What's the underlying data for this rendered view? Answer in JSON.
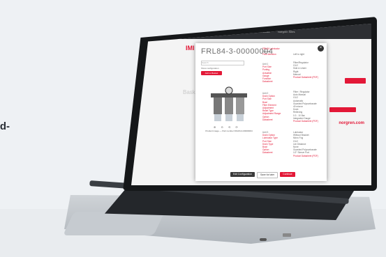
{
  "left_text": "rd-",
  "site": {
    "logo": "IMI",
    "heading": "Basket",
    "brand": "norgren.com",
    "topbar_links": [
      "Login",
      "Contact",
      "Norgren Sites"
    ]
  },
  "modal": {
    "title": "FRL84-3-00000004",
    "search_placeholder": "Search",
    "checkbox_label": "Show configuration",
    "add_button": "Add to Basket",
    "caption": "Product image — Part number FRL84-3-00000004",
    "thumb_icons": "⊕ ⊖ ⟲ ⟳",
    "close_label": "×",
    "buttons": {
      "edit": "Edit Configuration",
      "save": "Save for later",
      "continue": "Continue"
    },
    "spec_sections": [
      {
        "heading": "FRL84 Lubricator",
        "items": [
          "Options",
          "Flow direction"
        ],
        "values": [
          "Left to right"
        ]
      },
      {
        "heading": "Unit 1",
        "items": [
          "Port Size",
          "Porting",
          "Actuation",
          "Gauge",
          "Function",
          "Datasheet"
        ],
        "values": [
          "Filter/Regulator",
          "G1/2",
          "Side & Under",
          "Right",
          "Manual",
          "Product Datasheet (PDF)"
        ]
      },
      {
        "heading": "Unit 2",
        "items": [
          "Drain Option",
          "Port Size",
          "Bowl",
          "Filter Element",
          "Adjustment",
          "Relief Type",
          "Adjustment Range",
          "Option",
          "Datasheet"
        ],
        "values": [
          "Filter / Regulator",
          "Auto Manual",
          "G1/2",
          "Automatic",
          "Guarded Polycarbonate",
          "40 micron",
          "Knob",
          "Relieving",
          "0.3 - 10 Bar",
          "Integrated Gauge",
          "Product Datasheet (PDF)"
        ]
      },
      {
        "heading": "Unit 3",
        "items": [
          "Drain Option",
          "Lubricator Type",
          "Port Size",
          "Drain Type",
          "Bowl",
          "Option",
          "Datasheet"
        ],
        "values": [
          "Lubricator",
          "Without Bracket",
          "Micro Fog",
          "G1/2",
          "Lim Distance",
          "None",
          "Guarded Polycarbonate",
          "1/2\" Sleeve Port",
          "Product Datasheet (PDF)"
        ]
      }
    ]
  },
  "colors": {
    "brand_red": "#e31837",
    "dark": "#2d2f33"
  }
}
